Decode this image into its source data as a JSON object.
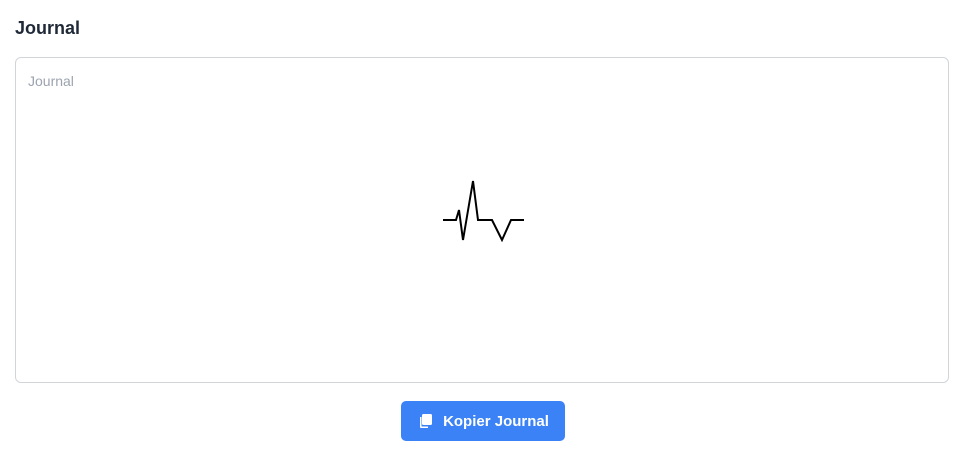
{
  "header": {
    "title": "Journal"
  },
  "journal": {
    "placeholder": "Journal",
    "loading_icon": "heartbeat-pulse-icon"
  },
  "actions": {
    "copy_label": "Kopier Journal",
    "copy_icon": "copy-icon"
  },
  "colors": {
    "accent": "#3b82f6",
    "title_text": "#1f2937",
    "placeholder_text": "#9ca3af",
    "border": "#d1d5db"
  }
}
